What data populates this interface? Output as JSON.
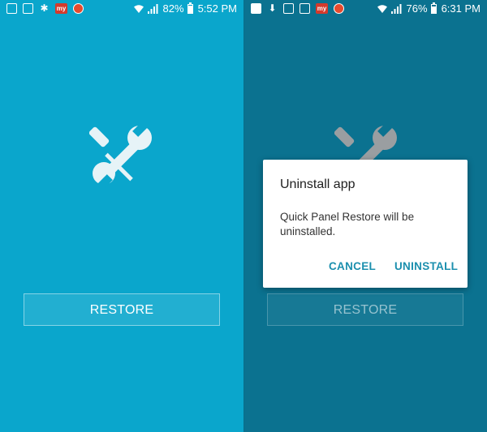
{
  "left_screen": {
    "status_bar": {
      "notification_icons": [
        "save-icon",
        "image-icon",
        "settings-icon",
        "my-app-icon",
        "orange-app-icon"
      ],
      "battery_percent": "82%",
      "battery_level": 0.82,
      "time": "5:52 PM"
    },
    "app_icon": "tools-icon",
    "restore_button": "RESTORE"
  },
  "right_screen": {
    "status_bar": {
      "notification_icons": [
        "facebook-icon",
        "download-icon",
        "email-icon",
        "save-icon",
        "my-app-icon",
        "orange-app-icon"
      ],
      "battery_percent": "76%",
      "battery_level": 0.76,
      "time": "6:31 PM"
    },
    "app_icon": "tools-icon",
    "restore_button": "RESTORE",
    "dialog": {
      "title": "Uninstall app",
      "message": "Quick Panel Restore will be uninstalled.",
      "cancel_label": "CANCEL",
      "confirm_label": "UNINSTALL"
    }
  },
  "colors": {
    "left_background": "#0aa6cc",
    "right_background_dimmed": "#0b7290",
    "dialog_button": "#1b8fae",
    "badge_red": "#d43a2c"
  }
}
